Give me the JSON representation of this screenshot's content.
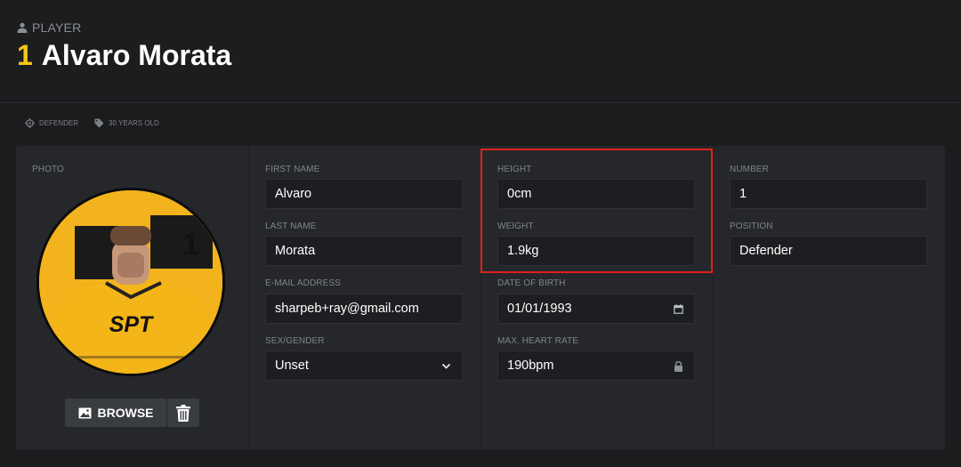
{
  "header": {
    "kicker": "PLAYER",
    "number": "1",
    "name": "Alvaro Morata",
    "number_color": "#f5c518"
  },
  "tags": [
    {
      "icon": "crosshair-icon",
      "label": "DEFENDER"
    },
    {
      "icon": "tag-icon",
      "label": "30 YEARS OLD"
    }
  ],
  "photo": {
    "label": "PHOTO",
    "jersey_number": "1",
    "jersey_text": "SPT",
    "browse_label": "BROWSE",
    "browse_icon": "image-icon",
    "delete_icon": "trash-icon"
  },
  "fields": {
    "first_name": {
      "label": "FIRST NAME",
      "value": "Alvaro"
    },
    "last_name": {
      "label": "LAST NAME",
      "value": "Morata"
    },
    "email": {
      "label": "E-MAIL ADDRESS",
      "value": "sharpeb+ray@gmail.com"
    },
    "sex": {
      "label": "SEX/GENDER",
      "value": "Unset",
      "icon": "chevron-down-icon"
    },
    "height": {
      "label": "HEIGHT",
      "value": "0cm"
    },
    "weight": {
      "label": "WEIGHT",
      "value": "1.9kg"
    },
    "dob": {
      "label": "DATE OF BIRTH",
      "value": "01/01/1993",
      "icon": "calendar-icon"
    },
    "heart_rate": {
      "label": "MAX. HEART RATE",
      "value": "190bpm",
      "icon": "lock-icon"
    },
    "number": {
      "label": "NUMBER",
      "value": "1"
    },
    "position": {
      "label": "POSITION",
      "value": "Defender"
    }
  },
  "colors": {
    "background": "#1b1c1e",
    "panel": "#25272a",
    "input": "#1d1e21",
    "accent": "#f5c518",
    "highlight": "#e0201f"
  }
}
